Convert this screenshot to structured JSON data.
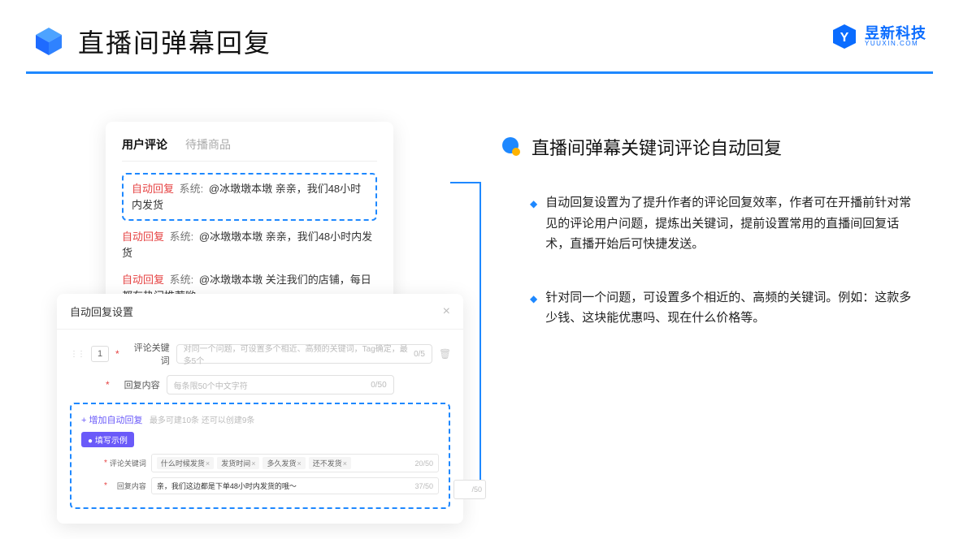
{
  "header": {
    "title": "直播间弹幕回复"
  },
  "brand": {
    "cn": "昱新科技",
    "en": "YUUXIN.COM"
  },
  "comments": {
    "tab_active": "用户评论",
    "tab_inactive": "待播商品",
    "auto_tag": "自动回复",
    "sys_tag": "系统:",
    "highlighted": "@冰墩墩本墩 亲亲，我们48小时内发货",
    "line2": "@冰墩墩本墩 亲亲，我们48小时内发货",
    "line3": "@冰墩墩本墩 关注我们的店铺，每日都有热门推荐哟～"
  },
  "settings": {
    "title": "自动回复设置",
    "index": "1",
    "kw_label": "评论关键词",
    "kw_placeholder": "对同一个问题，可设置多个相近、高频的关键词，Tag确定，最多5个",
    "kw_count": "0/5",
    "reply_label": "回复内容",
    "reply_placeholder": "每条限50个中文字符",
    "reply_count": "0/50",
    "add_text": "+ 增加自动回复",
    "add_note": "最多可建10条 还可以创建9条",
    "purple": "● 填写示例",
    "ex_kw_label": "评论关键词",
    "ex_kw_chips": [
      "什么时候发货",
      "发货时间",
      "多久发货",
      "还不发货"
    ],
    "ex_kw_count": "20/50",
    "ex_reply_label": "回复内容",
    "ex_reply_text": "亲，我们这边都是下单48小时内发货的哦～",
    "ex_reply_count": "37/50",
    "ghost_count": "/50"
  },
  "right": {
    "heading": "直播间弹幕关键词评论自动回复",
    "b1": "自动回复设置为了提升作者的评论回复效率，作者可在开播前针对常见的评论用户问题，提炼出关键词，提前设置常用的直播间回复话术，直播开始后可快捷发送。",
    "b2": "针对同一个问题，可设置多个相近的、高频的关键词。例如：这款多少钱、这块能优惠吗、现在什么价格等。"
  }
}
